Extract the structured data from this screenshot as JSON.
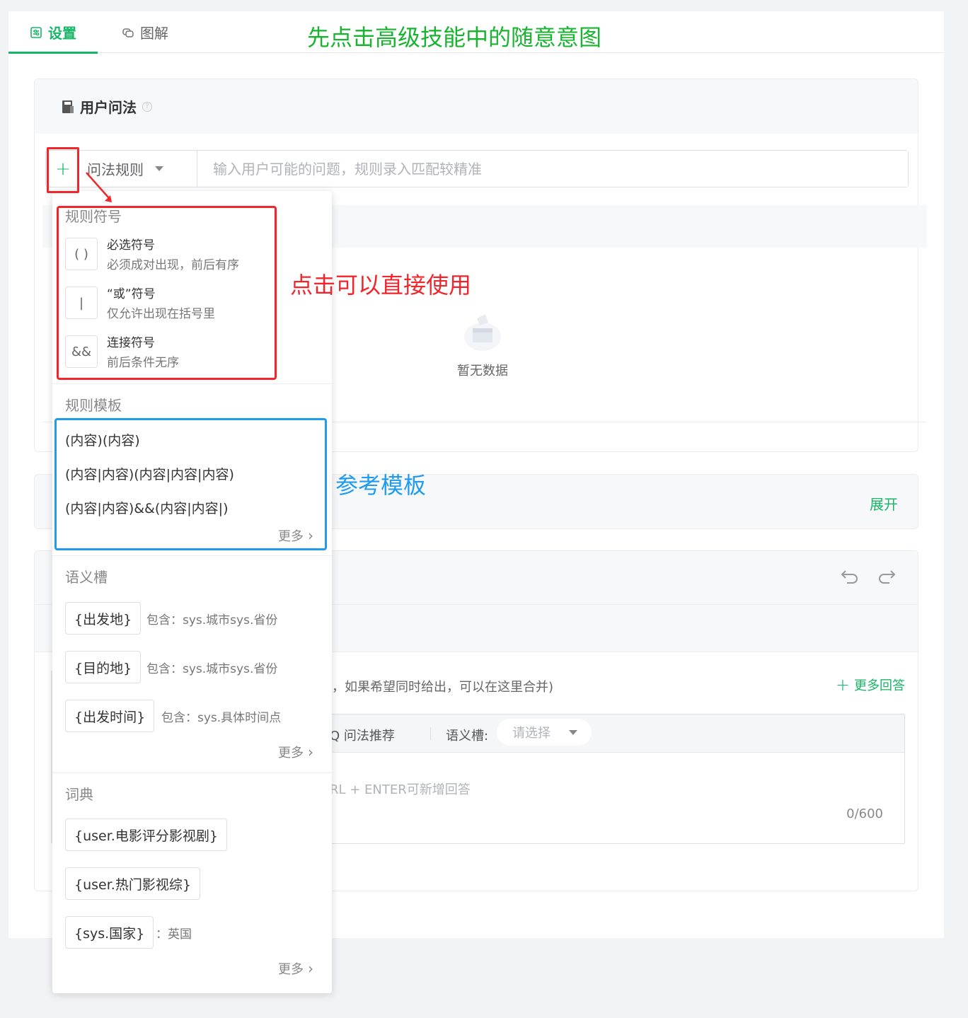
{
  "tabs": {
    "settings": "设置",
    "diagram": "图解"
  },
  "annotations": {
    "top_note": "先点击高级技能中的随意意图",
    "symbols_note": "点击可以直接使用",
    "templates_note": "参考模板"
  },
  "user_phrasing": {
    "title": "用户问法",
    "help": "?",
    "plus": "+",
    "rule_type": "问法规则",
    "input_placeholder": "输入用户可能的问题，规则录入匹配较精准",
    "empty_text": "暂无数据"
  },
  "expand_card": {
    "expand_label": "展开"
  },
  "answer_card": {
    "hint": "，如果希望同时给出，可以在这里合并)",
    "more_answers": "更多回答",
    "faq_recommend": "Q 问法推荐",
    "slot_label": "语义槽:",
    "slot_placeholder": "请选择",
    "editor_placeholder": "RL + ENTER可新增回答",
    "counter": "0/600"
  },
  "dropdown": {
    "symbols_title": "规则符号",
    "symbols": [
      {
        "glyph": "( )",
        "name": "必选符号",
        "desc": "必须成对出现，前后有序"
      },
      {
        "glyph": "|",
        "name": "“或”符号",
        "desc": "仅允许出现在括号里"
      },
      {
        "glyph": "&&",
        "name": "连接符号",
        "desc": "前后条件无序"
      }
    ],
    "templates_title": "规则模板",
    "templates": [
      "(内容)(内容)",
      "(内容|内容)(内容|内容|内容)",
      "(内容|内容)&&(内容|内容|)"
    ],
    "more": "更多",
    "slots_title": "语义槽",
    "slots": [
      {
        "tag": "{出发地}",
        "desc": "包含：sys.城市sys.省份"
      },
      {
        "tag": "{目的地}",
        "desc": "包含：sys.城市sys.省份"
      },
      {
        "tag": "{出发时间}",
        "desc": "包含：sys.具体时间点"
      }
    ],
    "dict_title": "词典",
    "dicts": [
      {
        "tag": "{user.电影评分影视剧}",
        "desc": ""
      },
      {
        "tag": "{user.热门影视综}",
        "desc": ""
      },
      {
        "tag": "{sys.国家}",
        "desc": "：英国"
      }
    ]
  },
  "colors": {
    "brand_green": "#18b566",
    "annotation_red": "#f0262c",
    "annotation_blue": "#1f9bf0",
    "annotation_green": "#18b42f"
  }
}
